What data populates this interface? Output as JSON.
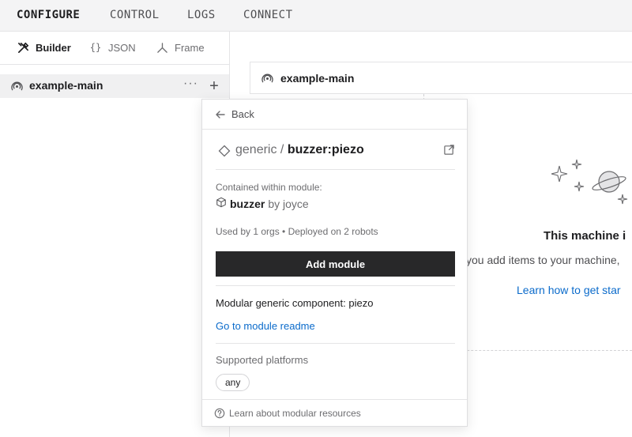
{
  "nav": {
    "tabs": [
      {
        "label": "CONFIGURE",
        "active": true
      },
      {
        "label": "CONTROL",
        "active": false
      },
      {
        "label": "LOGS",
        "active": false
      },
      {
        "label": "CONNECT",
        "active": false
      }
    ]
  },
  "sidebar": {
    "subtabs": [
      {
        "label": "Builder",
        "icon": "tools-icon",
        "active": true
      },
      {
        "label": "JSON",
        "icon": "braces-icon",
        "active": false
      },
      {
        "label": "Frame",
        "icon": "frame-icon",
        "active": false
      }
    ],
    "tree": {
      "label": "example-main",
      "more": "···",
      "add": "+"
    }
  },
  "main": {
    "machine_label": "example-main",
    "empty_state": {
      "title": "This machine i",
      "description": "you add items to your machine,",
      "link": "Learn how to get star"
    }
  },
  "popover": {
    "back_label": "Back",
    "api": "generic",
    "separator": " / ",
    "model": "buzzer:piezo",
    "contained_label": "Contained within module:",
    "module_name": "buzzer",
    "module_by": "by joyce",
    "usage": "Used by 1 orgs • Deployed on 2 robots",
    "add_button": "Add module",
    "description": "Modular generic component: piezo",
    "readme_link": "Go to module readme",
    "platforms_label": "Supported platforms",
    "platforms": [
      "any"
    ],
    "footer_link": "Learn about modular resources"
  },
  "colors": {
    "accent_link": "#0b6bcb",
    "button_bg": "#282829",
    "nav_bg": "#f4f4f5"
  }
}
